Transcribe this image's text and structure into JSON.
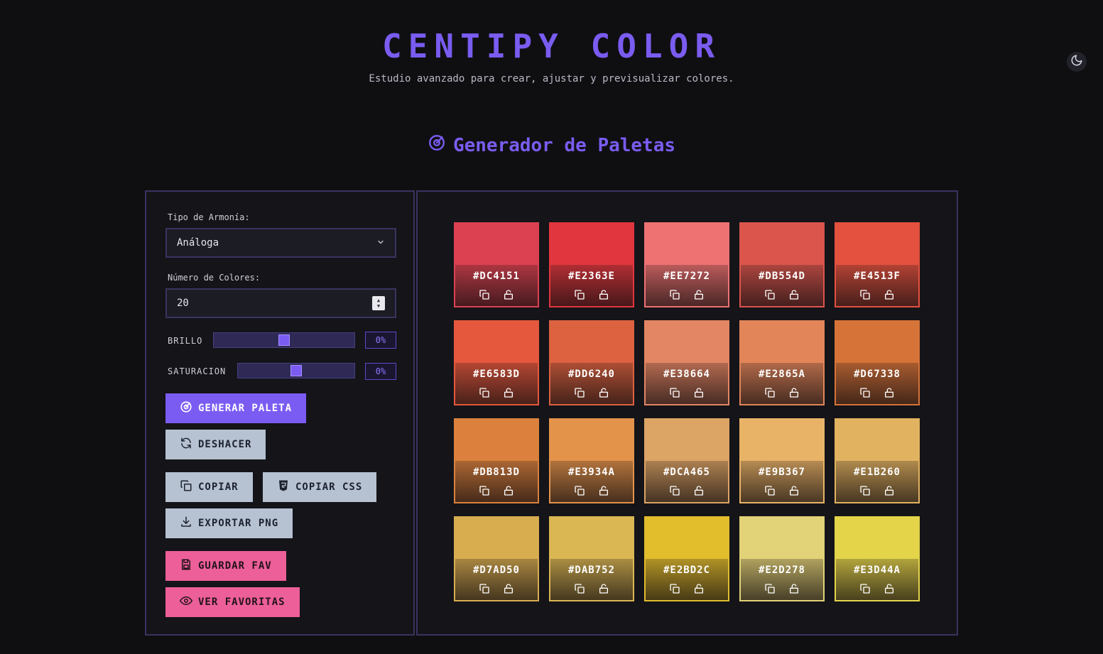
{
  "header": {
    "title": "CENTIPY COLOR",
    "subtitle": "Estudio avanzado para crear, ajustar y previsualizar colores."
  },
  "section": {
    "title": "Generador de Paletas"
  },
  "controls": {
    "harmony_label": "Tipo de Armonía:",
    "harmony_value": "Análoga",
    "count_label": "Número de Colores:",
    "count_value": "20",
    "brightness_label": "BRILLO",
    "brightness_value": "0%",
    "brightness_level": 0,
    "saturation_label": "SATURACION",
    "saturation_value": "0%",
    "saturation_level": 0
  },
  "buttons": {
    "generate": "GENERAR PALETA",
    "undo": "DESHACER",
    "copy": "COPIAR",
    "copy_css": "COPIAR CSS",
    "export_png": "EXPORTAR PNG",
    "save_fav": "GUARDAR FAV",
    "view_favs": "VER FAVORITAS"
  },
  "palette": [
    {
      "hex": "#DC4151"
    },
    {
      "hex": "#E2363E"
    },
    {
      "hex": "#EE7272"
    },
    {
      "hex": "#DB554D"
    },
    {
      "hex": "#E4513F"
    },
    {
      "hex": "#E6583D"
    },
    {
      "hex": "#DD6240"
    },
    {
      "hex": "#E38664"
    },
    {
      "hex": "#E2865A"
    },
    {
      "hex": "#D67338"
    },
    {
      "hex": "#DB813D"
    },
    {
      "hex": "#E3934A"
    },
    {
      "hex": "#DCA465"
    },
    {
      "hex": "#E9B367"
    },
    {
      "hex": "#E1B260"
    },
    {
      "hex": "#D7AD50"
    },
    {
      "hex": "#DAB752"
    },
    {
      "hex": "#E2BD2C"
    },
    {
      "hex": "#E2D278"
    },
    {
      "hex": "#E3D44A"
    }
  ],
  "colors": {
    "accent": "#7b5cf2",
    "background": "#0f0f12",
    "panel_border": "#3a3360",
    "secondary_button": "#b6c2d1",
    "pink_button": "#ec5f98"
  },
  "icons": {
    "theme": "moon-icon",
    "section": "target-icon",
    "swatch_copy": "copy-icon",
    "swatch_lock": "unlock-icon"
  }
}
